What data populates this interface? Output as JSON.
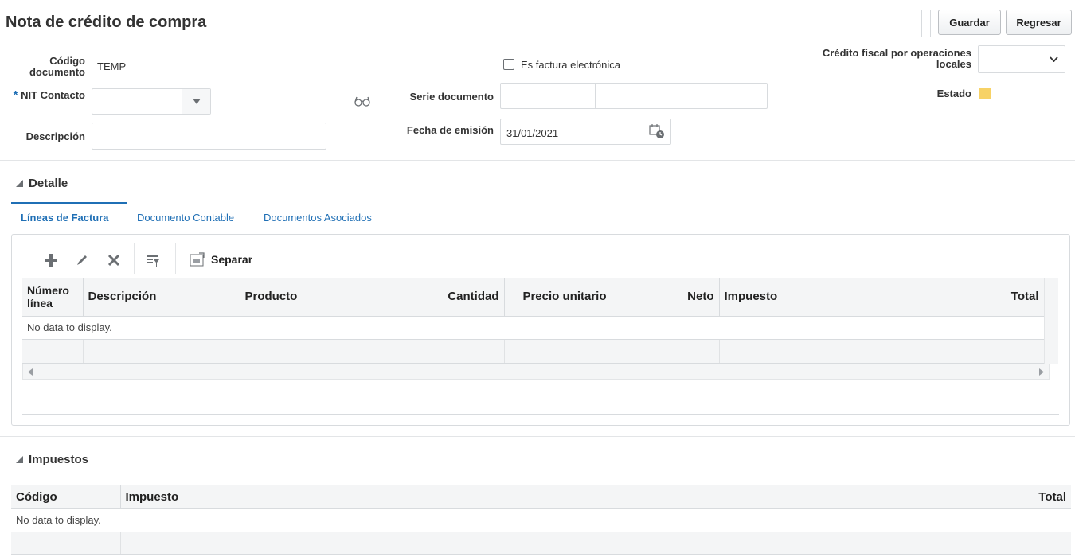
{
  "header": {
    "title": "Nota de crédito de compra",
    "save_label": "Guardar",
    "back_label": "Regresar"
  },
  "form": {
    "codigo_label": "Código documento",
    "codigo_value": "TEMP",
    "nit_required": "*",
    "nit_label": "NIT Contacto",
    "descripcion_label": "Descripción",
    "es_factura_label": "Es factura electrónica",
    "serie_label": "Serie documento",
    "fecha_label": "Fecha de emisión",
    "fecha_value": "31/01/2021",
    "credito_label": "Crédito fiscal por operaciones locales",
    "estado_label": "Estado",
    "estado_color": "#f7d266"
  },
  "detalle": {
    "section_title": "Detalle",
    "tabs": [
      {
        "label": "Líneas de Factura",
        "active": true
      },
      {
        "label": "Documento Contable",
        "active": false
      },
      {
        "label": "Documentos Asociados",
        "active": false
      }
    ],
    "toolbar": {
      "icons": [
        "plus-icon",
        "pencil-icon",
        "delete-icon",
        "filter-icon",
        "detach-icon"
      ],
      "separar_label": "Separar"
    },
    "columns": [
      "Número línea",
      "Descripción",
      "Producto",
      "Cantidad",
      "Precio unitario",
      "Neto",
      "Impuesto",
      "Total"
    ],
    "no_data": "No data to display."
  },
  "impuestos": {
    "section_title": "Impuestos",
    "columns": [
      "Código",
      "Impuesto",
      "Total"
    ],
    "no_data": "No data to display."
  }
}
